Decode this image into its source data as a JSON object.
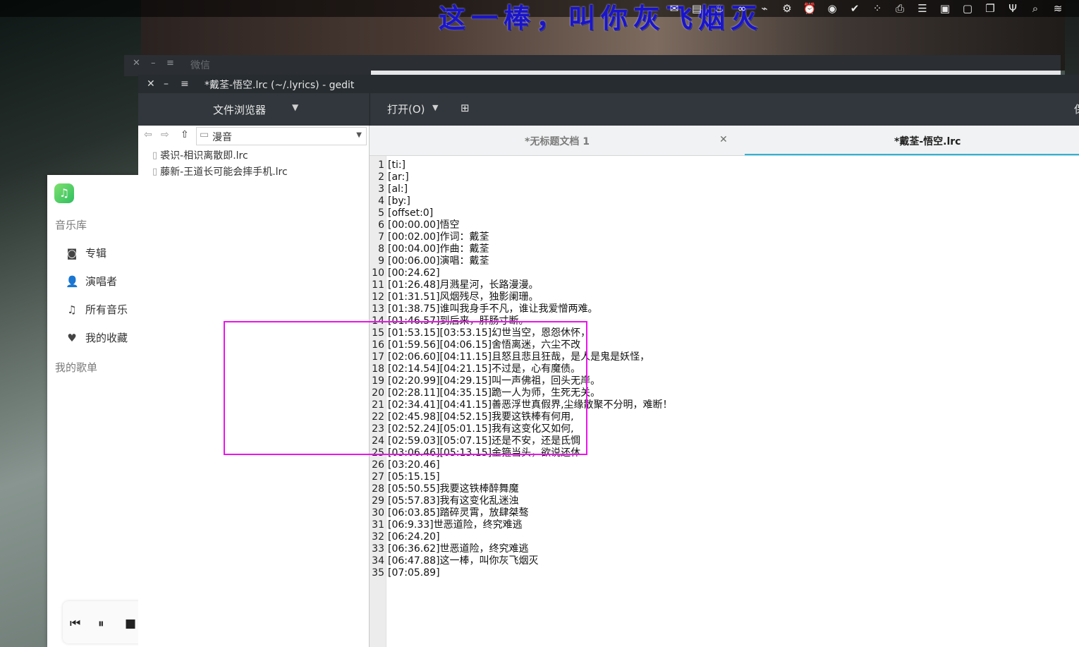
{
  "desktop_overlay_lyric": "这一棒，叫你灰飞烟灭",
  "tray_icons": [
    "mail-icon",
    "archive-icon",
    "flame-icon",
    "infinity-icon",
    "usb-icon",
    "gear-icon",
    "alarm-icon",
    "eye-icon",
    "check-icon",
    "grid-icon",
    "printer-icon",
    "menu-icon",
    "terminal-icon",
    "clipboard-icon",
    "window-icon",
    "usb-plug-icon",
    "search-icon",
    "wifi-icon",
    "bluetooth-icon"
  ],
  "wechat": {
    "title": "微信"
  },
  "music_app": {
    "library_label": "音乐库",
    "items": [
      {
        "label": "专辑",
        "icon": "album-icon"
      },
      {
        "label": "演唱者",
        "icon": "person-icon"
      },
      {
        "label": "所有音乐",
        "icon": "note-icon"
      },
      {
        "label": "我的收藏",
        "icon": "heart-icon"
      }
    ],
    "playlist_label": "我的歌单"
  },
  "gedit": {
    "title": "*戴荃-悟空.lrc (~/.lyrics) - gedit",
    "side_panel_title": "文件浏览器",
    "open_label": "打开(O)",
    "save_label": "保",
    "path": "漫音",
    "files": [
      "裘识-相识离散即.lrc",
      "藤新-王道长可能会摔手机.lrc"
    ],
    "tabs": [
      {
        "label": "*无标题文档 1"
      },
      {
        "label": "*戴荃-悟空.lrc"
      }
    ],
    "lines": [
      "[ti:]",
      "[ar:]",
      "[al:]",
      "[by:]",
      "[offset:0]",
      "[00:00.00]悟空",
      "[00:02.00]作词：戴荃",
      "[00:04.00]作曲：戴荃",
      "[00:06.00]演唱：戴荃",
      "[00:24.62]",
      "[01:26.48]月溅星河，长路漫漫。",
      "[01:31.51]风烟残尽，独影阑珊。",
      "[01:38.75]谁叫我身手不凡，谁让我爱憎两难。",
      "[01:46.57]到后来，肝肠寸断。",
      "[01:53.15][03:53.15]幻世当空，恩怨休怀，",
      "[01:59.56][04:06.15]舍悟离迷，六尘不改",
      "[02:06.60][04:11.15]且怒且悲且狂哉，是人是鬼是妖怪，",
      "[02:14.54][04:21.15]不过是，心有魔债。",
      "[02:20.99][04:29.15]叫一声佛祖，回头无岸。",
      "[02:28.11][04:35.15]跪一人为师，生死无关。",
      "[02:34.41][04:41.15]善恶浮世真假界,尘缘散聚不分明，难断！",
      "[02:45.98][04:52.15]我要这铁棒有何用,",
      "[02:52.24][05:01.15]我有这变化又如何,",
      "[02:59.03][05:07.15]还是不安，还是氐惆",
      "[03:06.46][05:13.15]金箍当头，欲说还休",
      "[03:20.46]",
      "[05:15.15]",
      "[05:50.55]我要这铁棒醉舞魔",
      "[05:57.83]我有这变化乱迷浊",
      "[06:03.85]踏碎灵霄，放肆桀骜",
      "[06:9.33]世恶道险，终究难逃",
      "[06:24.20]",
      "[06:36.62]世恶道险，终究难逃",
      "[06:47.88]这一棒，叫你灰飞烟灭",
      "[07:05.89]"
    ]
  },
  "colors": {
    "highlight": "#ea14ea",
    "tab_accent": "#2bb5d8"
  }
}
